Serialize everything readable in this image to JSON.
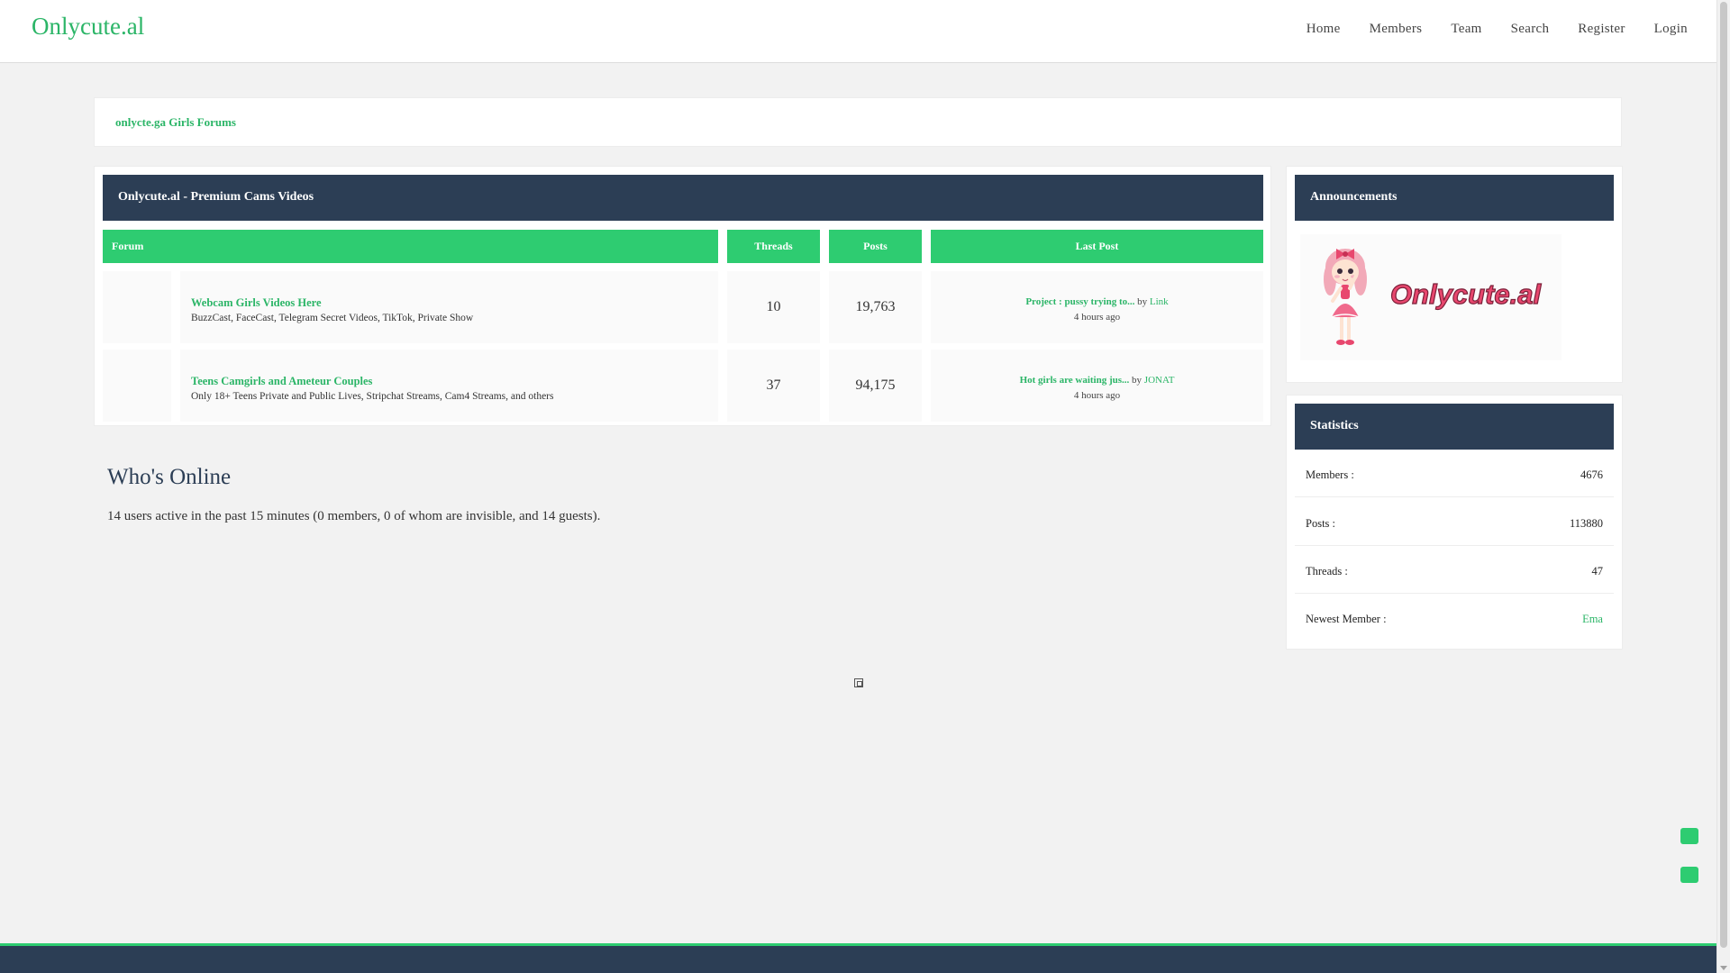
{
  "header": {
    "brand": "Onlycute.al",
    "nav": [
      "Home",
      "Members",
      "Team",
      "Search",
      "Register",
      "Login"
    ]
  },
  "breadcrumb": "onlycte.ga Girls Forums",
  "forum_panel": {
    "title": "Onlycute.al - Premium Cams Videos",
    "columns": {
      "forum": "Forum",
      "threads": "Threads",
      "posts": "Posts",
      "last": "Last Post"
    },
    "rows": [
      {
        "title": "Webcam Girls Videos Here",
        "description": "BuzzCast, FaceCast, Telegram Secret Videos, TikTok, Private Show",
        "threads": "10",
        "posts": "19,763",
        "last_title": "Project : pussy trying to...",
        "last_by": "by",
        "last_user": "Link",
        "last_time": "4 hours ago"
      },
      {
        "title": "Teens Camgirls and Ameteur Couples",
        "description": "Only 18+ Teens Private and Public Lives, Stripchat Streams, Cam4 Streams, and others",
        "threads": "37",
        "posts": "94,175",
        "last_title": "Hot girls are waiting jus...",
        "last_by": "by",
        "last_user": "JONAT",
        "last_time": "4 hours ago"
      }
    ]
  },
  "who_online": {
    "title": "Who's Online",
    "text": "14 users active in the past 15 minutes (0 members, 0 of whom are invisible, and 14 guests)."
  },
  "announcements": {
    "title": "Announcements",
    "logo_text": "Onlycute.al"
  },
  "statistics": {
    "title": "Statistics",
    "members_label": "Members :",
    "members": "4676",
    "posts_label": "Posts :",
    "posts": "113880",
    "threads_label": "Threads :",
    "threads": "47",
    "newest_label": "Newest Member :",
    "newest": "Ema"
  },
  "colors": {
    "accent": "#2ecc71",
    "link": "#2bb567",
    "panel_head": "#2c3e55"
  }
}
